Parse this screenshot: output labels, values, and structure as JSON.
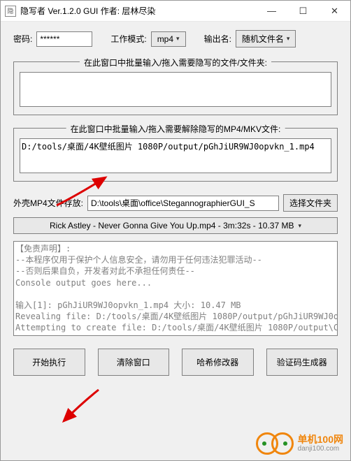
{
  "window": {
    "title": "隐写者 Ver.1.2.0 GUI 作者: 层林尽染"
  },
  "row1": {
    "pwd_label": "密码:",
    "pwd_value": "******",
    "mode_label": "工作模式:",
    "mode_btn": "mp4",
    "out_label": "输出名:",
    "out_btn": "随机文件名"
  },
  "group1": {
    "legend": "在此窗口中批量输入/拖入需要隐写的文件/文件夹:",
    "text": ""
  },
  "group2": {
    "legend": "在此窗口中批量输入/拖入需要解除隐写的MP4/MKV文件:",
    "text": "D:/tools/桌面/4K壁纸图片 1080P/output/pGhJiUR9WJ0opvkn_1.mp4"
  },
  "shell": {
    "label": "外壳MP4文件存放:",
    "path": "D:\\tools\\桌面\\office\\StegannographierGUI_S",
    "browse": "选择文件夹",
    "file": "Rick Astley - Never Gonna Give You Up.mp4 - 3m:32s - 10.37 MB"
  },
  "console": "【免责声明】:\n--本程序仅用于保护个人信息安全，请勿用于任何违法犯罪活动--\n--否则后果自负，开发者对此不承担任何责任--\nConsole output goes here...\n\n输入[1]: pGhJiUR9WJ0opvkn_1.mp4 大小: 10.47 MB\nRevealing file: D:/tools/桌面/4K壁纸图片 1080P/output/pGhJiUR9WJ0o\nAttempting to create file: D:/tools/桌面/4K壁纸图片 1080P/output\\C\nFile extracted successfully",
  "buttons": {
    "exec": "开始执行",
    "clear": "清除窗口",
    "hash": "哈希修改器",
    "verify": "验证码生成器"
  },
  "watermark": {
    "brand": "单机100网",
    "url": "danji100.com"
  }
}
